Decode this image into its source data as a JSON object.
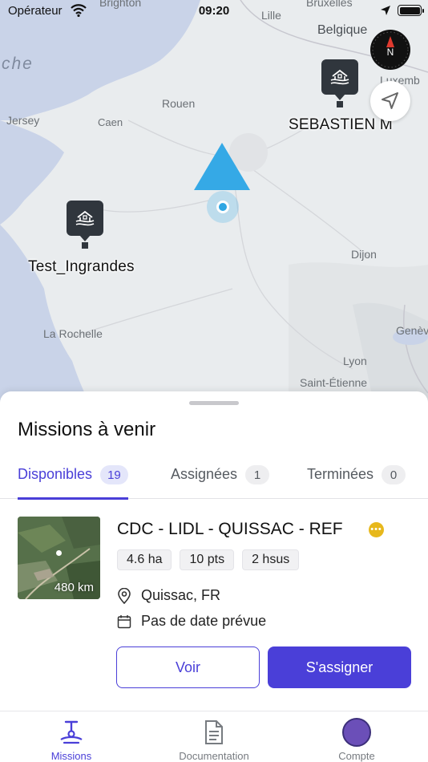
{
  "status_bar": {
    "carrier": "Opérateur",
    "time": "09:20"
  },
  "map": {
    "places": [
      {
        "id": "brighton",
        "name": "Brighton"
      },
      {
        "id": "lille",
        "name": "Lille"
      },
      {
        "id": "bruxelles",
        "name": "Bruxelles"
      },
      {
        "id": "belgique",
        "name": "Belgique"
      },
      {
        "id": "manche",
        "name": "che"
      },
      {
        "id": "luxembourg",
        "name": "Luxemb"
      },
      {
        "id": "rouen",
        "name": "Rouen"
      },
      {
        "id": "jersey",
        "name": "Jersey"
      },
      {
        "id": "caen",
        "name": "Caen"
      },
      {
        "id": "dijon",
        "name": "Dijon"
      },
      {
        "id": "larochelle",
        "name": "La Rochelle"
      },
      {
        "id": "geneve",
        "name": "Genèv"
      },
      {
        "id": "lyon",
        "name": "Lyon"
      },
      {
        "id": "saintetienne",
        "name": "Saint-Étienne"
      }
    ],
    "pins": [
      {
        "label": "SEBASTIEN M"
      },
      {
        "label": "Test_Ingrandes"
      }
    ],
    "compass_letter": "N"
  },
  "sheet": {
    "title": "Missions à venir",
    "tabs": [
      {
        "label": "Disponibles",
        "count": "19",
        "active": true
      },
      {
        "label": "Assignées",
        "count": "1",
        "active": false
      },
      {
        "label": "Terminées",
        "count": "0",
        "active": false
      }
    ],
    "mission": {
      "title": "CDC - LIDL - QUISSAC - REF",
      "distance": "480 km",
      "chips": [
        "4.6 ha",
        "10 pts",
        "2 hsus"
      ],
      "location": "Quissac, FR",
      "date": "Pas de date prévue",
      "view_label": "Voir",
      "assign_label": "S'assigner"
    }
  },
  "bottom_nav": {
    "items": [
      {
        "label": "Missions",
        "active": true
      },
      {
        "label": "Documentation",
        "active": false
      },
      {
        "label": "Compte",
        "active": false
      }
    ]
  },
  "colors": {
    "accent": "#4a3fd8",
    "warning": "#e7b81c",
    "map_water": "#c9d3e8",
    "user_location": "#2ea6e3"
  }
}
